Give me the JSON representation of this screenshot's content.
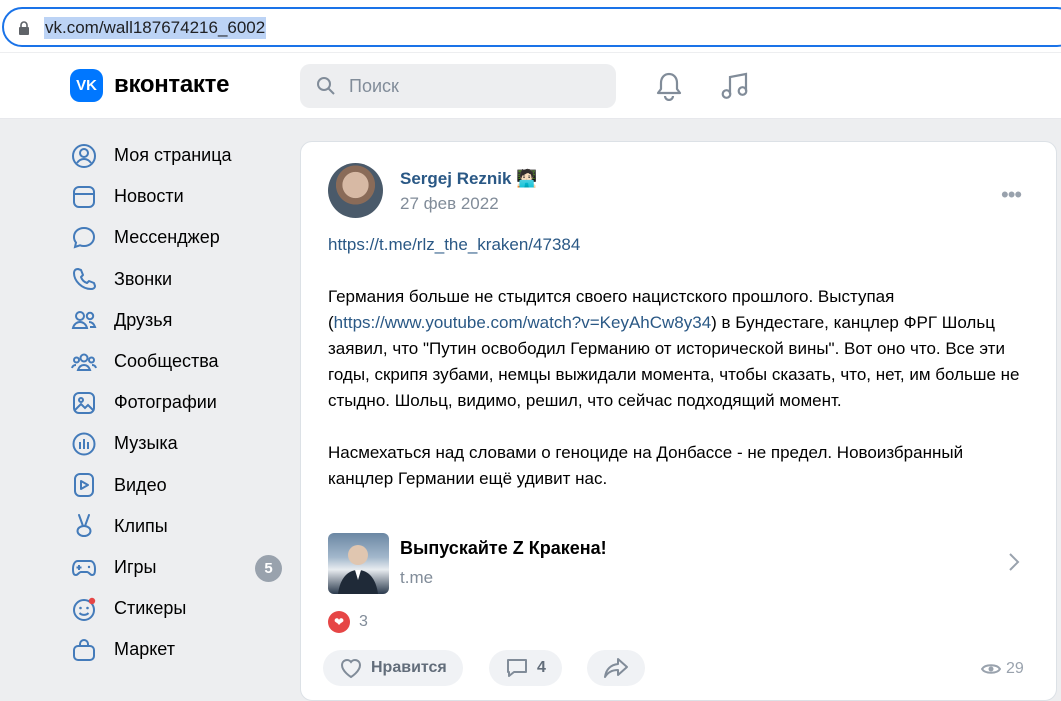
{
  "browser": {
    "url": "vk.com/wall187674216_6002"
  },
  "header": {
    "logo_mark": "VK",
    "logo_text": "вконтакте",
    "search_placeholder": "Поиск"
  },
  "sidebar": {
    "items": [
      {
        "label": "Моя страница",
        "icon": "user-circle-icon"
      },
      {
        "label": "Новости",
        "icon": "news-icon"
      },
      {
        "label": "Мессенджер",
        "icon": "message-icon"
      },
      {
        "label": "Звонки",
        "icon": "phone-icon"
      },
      {
        "label": "Друзья",
        "icon": "friends-icon"
      },
      {
        "label": "Сообщества",
        "icon": "communities-icon"
      },
      {
        "label": "Фотографии",
        "icon": "photo-icon"
      },
      {
        "label": "Музыка",
        "icon": "music-icon"
      },
      {
        "label": "Видео",
        "icon": "video-icon"
      },
      {
        "label": "Клипы",
        "icon": "clips-icon"
      },
      {
        "label": "Игры",
        "icon": "gamepad-icon",
        "badge": "5"
      },
      {
        "label": "Стикеры",
        "icon": "sticker-icon"
      },
      {
        "label": "Маркет",
        "icon": "market-icon"
      }
    ]
  },
  "post": {
    "author": "Sergej Reznik",
    "author_emoji": "🧑🏻‍💻",
    "date": "27 фев 2022",
    "link": "https://t.me/rlz_the_kraken/47384",
    "para1_before": "Германия больше не стыдится своего нацистского прошлого. Выступая (",
    "para1_link": "https://www.youtube.com/watch?v=KeyAhCw8y34",
    "para1_after": ") в Бундестаге, канцлер ФРГ Шольц заявил, что \"Путин освободил Германию от исторической вины\". Вот оно что. Все эти годы, скрипя зубами, немцы выжидали момента, чтобы сказать, что, нет, им больше не стыдно. Шольц, видимо, решил, что сейчас подходящий момент.",
    "para2": "Насмехаться над словами о геноциде на Донбассе - не предел. Новоизбранный канцлер Германии ещё удивит нас.",
    "snippet_title": "Выпускайте Z Кракена!",
    "snippet_domain": "t.me",
    "likes": "3",
    "like_label": "Нравится",
    "comments": "4",
    "views": "29"
  },
  "colors": {
    "accent": "#0077ff",
    "link": "#2a5885",
    "like": "#e64646"
  }
}
